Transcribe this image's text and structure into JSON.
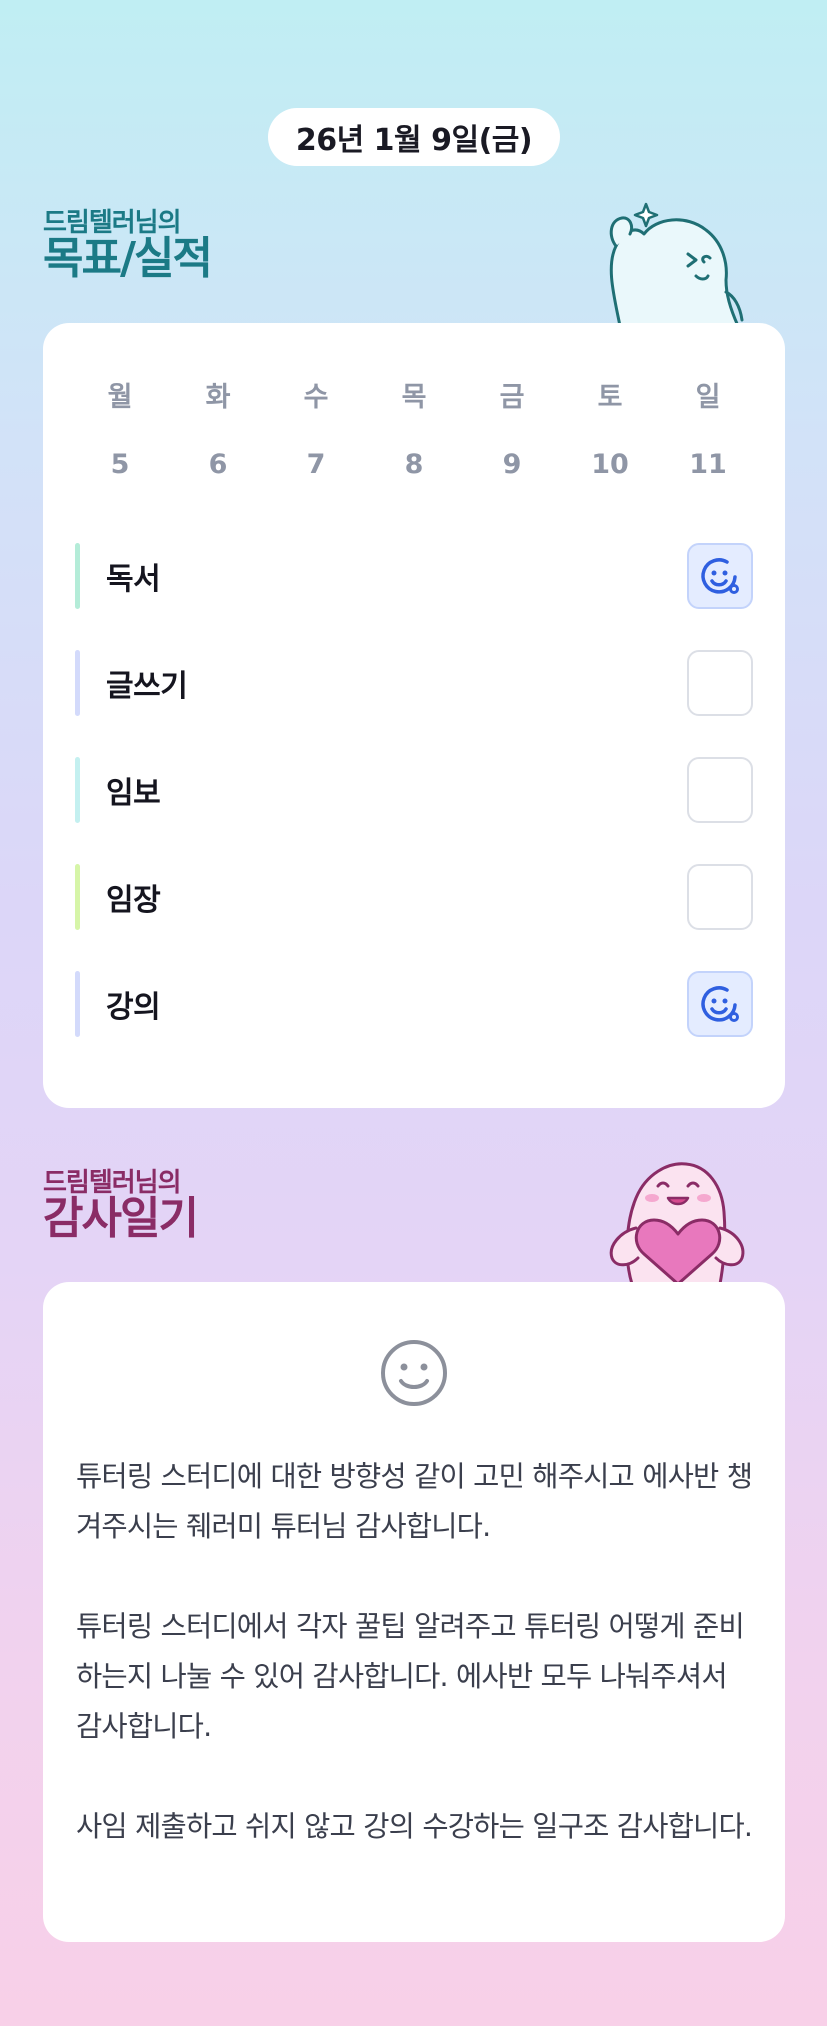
{
  "header": {
    "date": "26년 1월 9일(금)"
  },
  "goal_section": {
    "subtitle": "드림텔러님의",
    "title": "목표/실적",
    "weekdays": [
      "월",
      "화",
      "수",
      "목",
      "금",
      "토",
      "일"
    ],
    "dates": [
      "5",
      "6",
      "7",
      "8",
      "9",
      "10",
      "11"
    ],
    "goals": [
      {
        "label": "독서",
        "done": true,
        "bar_color": "#b4ecd8"
      },
      {
        "label": "글쓰기",
        "done": false,
        "bar_color": "#d3dafb"
      },
      {
        "label": "임보",
        "done": false,
        "bar_color": "#c4f0f0"
      },
      {
        "label": "임장",
        "done": false,
        "bar_color": "#d6f5a8"
      },
      {
        "label": "강의",
        "done": true,
        "bar_color": "#d3dafb"
      }
    ]
  },
  "thanks_section": {
    "subtitle": "드림텔러님의",
    "title": "감사일기",
    "paragraphs": [
      "튜터링 스터디에 대한 방향성 같이 고민 해주시고 에사반 챙겨주시는 줴러미 튜터님 감사합니다.",
      "튜터링 스터디에서 각자 꿀팁 알려주고 튜터링 어떻게 준비하는지 나눌 수 있어 감사합니다. 에사반 모두 나눠주셔서 감사합니다.",
      "사임 제출하고 쉬지 않고 강의 수강하는 일구조 감사합니다."
    ]
  },
  "colors": {
    "accent_blue": "#2f5fe0",
    "goal_title": "#1b7a86",
    "thanks_title": "#8a2c66"
  },
  "icons": {
    "goal_done": "smile-check-icon",
    "thanks_face": "smile-face-icon"
  }
}
